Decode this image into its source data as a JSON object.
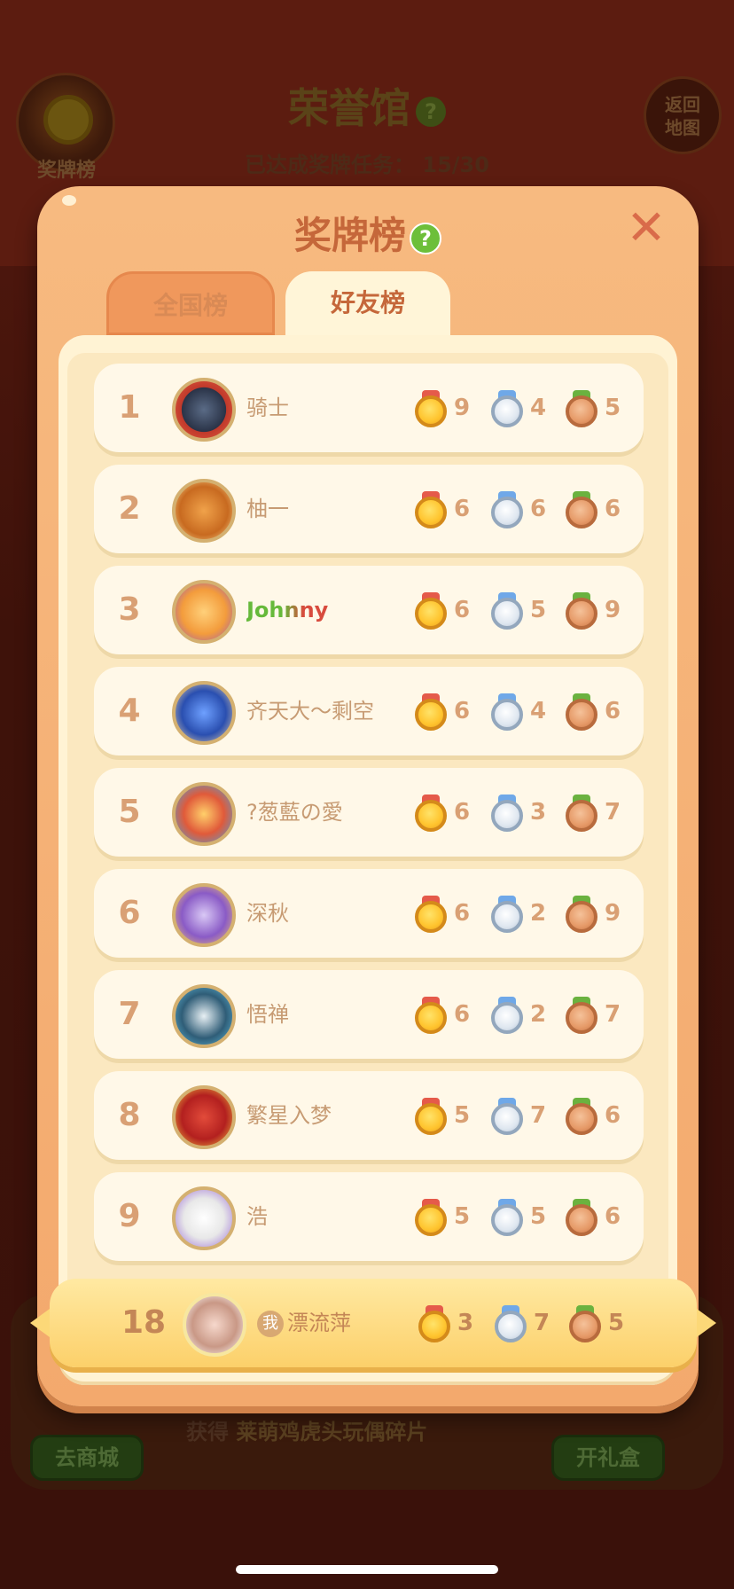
{
  "background": {
    "medal_label": "奖牌榜",
    "title": "荣誉馆",
    "help": "?",
    "progress_label": "已达成奖牌任务：",
    "progress_value": "15/30",
    "return_label_1": "返回",
    "return_label_2": "地图",
    "reward_prefix": "获得",
    "reward_item": "莱萌鸡虎头玩偶碎片",
    "shop_button": "去商城",
    "gift_button": "开礼盒"
  },
  "modal": {
    "title": "奖牌榜",
    "help": "?",
    "close": "✕",
    "tabs": [
      {
        "label": "全国榜",
        "active": false
      },
      {
        "label": "好友榜",
        "active": true
      }
    ]
  },
  "rows": [
    {
      "rank": "1",
      "name": "骑士",
      "gold": "9",
      "silver": "4",
      "bronze": "5",
      "avatar_color": "#c0392b"
    },
    {
      "rank": "2",
      "name": "柚一",
      "gold": "6",
      "silver": "6",
      "bronze": "6",
      "avatar_color": "#e79a3a"
    },
    {
      "rank": "3",
      "name": "Johnny",
      "gold": "6",
      "silver": "5",
      "bronze": "9",
      "avatar_color": "#f3b23c"
    },
    {
      "rank": "4",
      "name": "齐天大～剩空",
      "gold": "6",
      "silver": "4",
      "bronze": "6",
      "avatar_color": "#3a6fd1"
    },
    {
      "rank": "5",
      "name": "?葱藍の愛",
      "gold": "6",
      "silver": "3",
      "bronze": "7",
      "avatar_color": "#4aa3d9"
    },
    {
      "rank": "6",
      "name": "深秋",
      "gold": "6",
      "silver": "2",
      "bronze": "9",
      "avatar_color": "#8a5bc6"
    },
    {
      "rank": "7",
      "name": "悟禅",
      "gold": "6",
      "silver": "2",
      "bronze": "7",
      "avatar_color": "#2f5d77"
    },
    {
      "rank": "8",
      "name": "繁星入梦",
      "gold": "5",
      "silver": "7",
      "bronze": "6",
      "avatar_color": "#c0262a"
    },
    {
      "rank": "9",
      "name": "浩",
      "gold": "5",
      "silver": "5",
      "bronze": "6",
      "avatar_color": "#9a6bd6"
    }
  ],
  "me": {
    "rank": "18",
    "badge": "我",
    "name": "漂流萍",
    "gold": "3",
    "silver": "7",
    "bronze": "5",
    "avatar_color": "#f2c6b8"
  }
}
